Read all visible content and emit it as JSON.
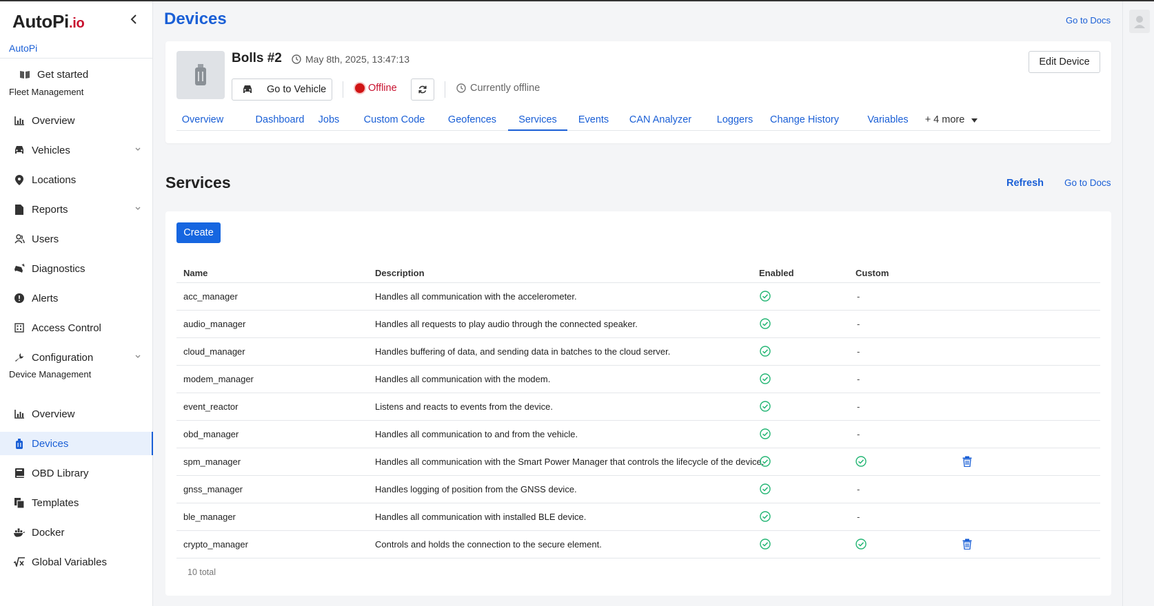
{
  "app": {
    "logo_main": "AutoPi",
    "logo_suffix": ".io",
    "org_name": "AutoPi"
  },
  "sidebar": {
    "get_started": "Get started",
    "fleet_heading": "Fleet Management",
    "fleet_items": [
      {
        "label": "Overview",
        "icon": "chart-icon"
      },
      {
        "label": "Vehicles",
        "icon": "car-icon",
        "expandable": true
      },
      {
        "label": "Locations",
        "icon": "map-pin-icon"
      },
      {
        "label": "Reports",
        "icon": "file-icon",
        "expandable": true
      },
      {
        "label": "Users",
        "icon": "users-icon"
      },
      {
        "label": "Diagnostics",
        "icon": "car-crash-icon"
      },
      {
        "label": "Alerts",
        "icon": "alert-icon"
      },
      {
        "label": "Access Control",
        "icon": "access-icon"
      },
      {
        "label": "Configuration",
        "icon": "wrench-icon",
        "expandable": true
      }
    ],
    "device_heading": "Device Management",
    "device_items": [
      {
        "label": "Overview",
        "icon": "chart-icon"
      },
      {
        "label": "Devices",
        "icon": "device-icon",
        "active": true
      },
      {
        "label": "OBD Library",
        "icon": "book-icon"
      },
      {
        "label": "Templates",
        "icon": "copy-icon"
      },
      {
        "label": "Docker",
        "icon": "docker-icon"
      },
      {
        "label": "Global Variables",
        "icon": "sqrt-icon"
      }
    ]
  },
  "header": {
    "title": "Devices",
    "docs_link": "Go to Docs"
  },
  "device": {
    "name": "Bolls #2",
    "timestamp": "May 8th, 2025, 13:47:13",
    "go_to_vehicle": "Go to Vehicle",
    "status": "Offline",
    "status_detail": "Currently offline",
    "edit": "Edit Device",
    "status_color": "#d01414"
  },
  "tabs": [
    "Overview",
    "Dashboard",
    "Jobs",
    "Custom Code",
    "Geofences",
    "Services",
    "Events",
    "CAN Analyzer",
    "Loggers",
    "Change History",
    "Variables",
    "+ 4 more"
  ],
  "active_tab": "Services",
  "services": {
    "title": "Services",
    "refresh": "Refresh",
    "docs_link": "Go to Docs",
    "create": "Create",
    "columns": {
      "name": "Name",
      "description": "Description",
      "enabled": "Enabled",
      "custom": "Custom"
    },
    "rows": [
      {
        "name": "acc_manager",
        "description": "Handles all communication with the accelerometer.",
        "enabled": true,
        "custom": "-"
      },
      {
        "name": "audio_manager",
        "description": "Handles all requests to play audio through the connected speaker.",
        "enabled": true,
        "custom": "-"
      },
      {
        "name": "cloud_manager",
        "description": "Handles buffering of data, and sending data in batches to the cloud server.",
        "enabled": true,
        "custom": "-"
      },
      {
        "name": "modem_manager",
        "description": "Handles all communication with the modem.",
        "enabled": true,
        "custom": "-"
      },
      {
        "name": "event_reactor",
        "description": "Listens and reacts to events from the device.",
        "enabled": true,
        "custom": "-"
      },
      {
        "name": "obd_manager",
        "description": "Handles all communication to and from the vehicle.",
        "enabled": true,
        "custom": "-"
      },
      {
        "name": "spm_manager",
        "description": "Handles all communication with the Smart Power Manager that controls the lifecycle of the device.",
        "enabled": true,
        "custom": true,
        "deletable": true
      },
      {
        "name": "gnss_manager",
        "description": "Handles logging of position from the GNSS device.",
        "enabled": true,
        "custom": "-"
      },
      {
        "name": "ble_manager",
        "description": "Handles all communication with installed BLE device.",
        "enabled": true,
        "custom": "-"
      },
      {
        "name": "crypto_manager",
        "description": "Controls and holds the connection to the secure element.",
        "enabled": true,
        "custom": true,
        "deletable": true
      }
    ],
    "total": "10 total"
  },
  "colors": {
    "accent": "#1a5fd6",
    "success": "#22b573",
    "danger": "#c8102e"
  }
}
